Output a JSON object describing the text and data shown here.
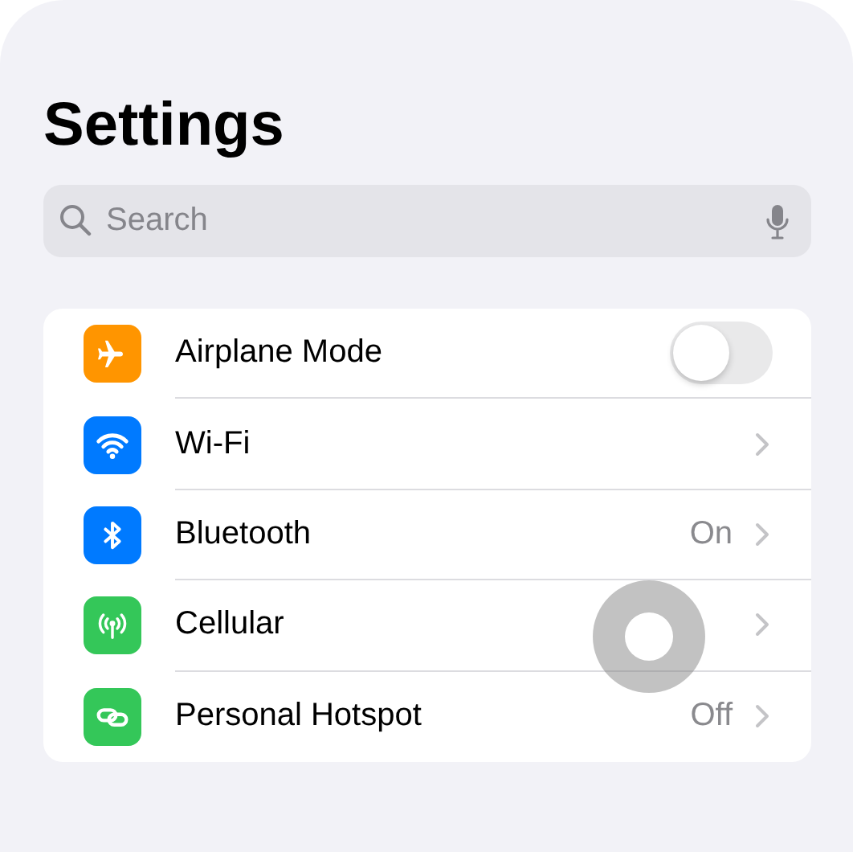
{
  "title": "Settings",
  "search": {
    "placeholder": "Search"
  },
  "rows": [
    {
      "kind": "toggle",
      "label": "Airplane Mode",
      "color": "#ff9500",
      "on": false
    },
    {
      "kind": "link",
      "label": "Wi-Fi",
      "color": "#007aff"
    },
    {
      "kind": "link",
      "label": "Bluetooth",
      "color": "#007aff",
      "value": "On"
    },
    {
      "kind": "link",
      "label": "Cellular",
      "color": "#34c759"
    },
    {
      "kind": "link",
      "label": "Personal Hotspot",
      "color": "#34c759",
      "value": "Off"
    }
  ]
}
